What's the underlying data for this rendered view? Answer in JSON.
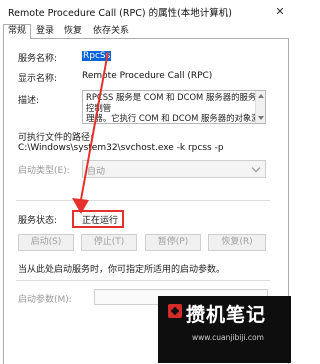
{
  "window": {
    "title": "Remote Procedure Call (RPC) 的属性(本地计算机)",
    "close_glyph": "✕"
  },
  "tabs": [
    {
      "label": "常规",
      "active": true
    },
    {
      "label": "登录",
      "active": false
    },
    {
      "label": "恢复",
      "active": false
    },
    {
      "label": "依存关系",
      "active": false
    }
  ],
  "general": {
    "service_name_label": "服务名称:",
    "service_name": "RpcSs",
    "display_name_label": "显示名称:",
    "display_name": "Remote Procedure Call (RPC)",
    "description_label": "描述:",
    "description": "RPCSS 服务是 COM 和 DCOM 服务器的服务控制管\n理器。它执行 COM 和 DCOM 服务器的对象激活请\n求、对象导出程序解析和分布式垃圾回收。如果此服务",
    "exe_path_label": "可执行文件的路径:",
    "exe_path": "C:\\Windows\\system32\\svchost.exe -k rpcss -p",
    "startup_type_label": "启动类型(E):",
    "startup_type_value": "自动",
    "service_status_label": "服务状态:",
    "service_status": "正在运行",
    "buttons": {
      "start": "启动(S)",
      "stop": "停止(T)",
      "pause": "暂停(P)",
      "resume": "恢复(R)"
    },
    "hint": "当从此处启动服务时，你可指定所适用的启动参数。",
    "start_params_label": "启动参数(M):"
  },
  "annotations": {
    "highlight_color": "#e4312b"
  },
  "watermark": {
    "title": "攒机笔记",
    "url": "www.cuanjibiji.com",
    "accent_color": "#d42a2a"
  }
}
